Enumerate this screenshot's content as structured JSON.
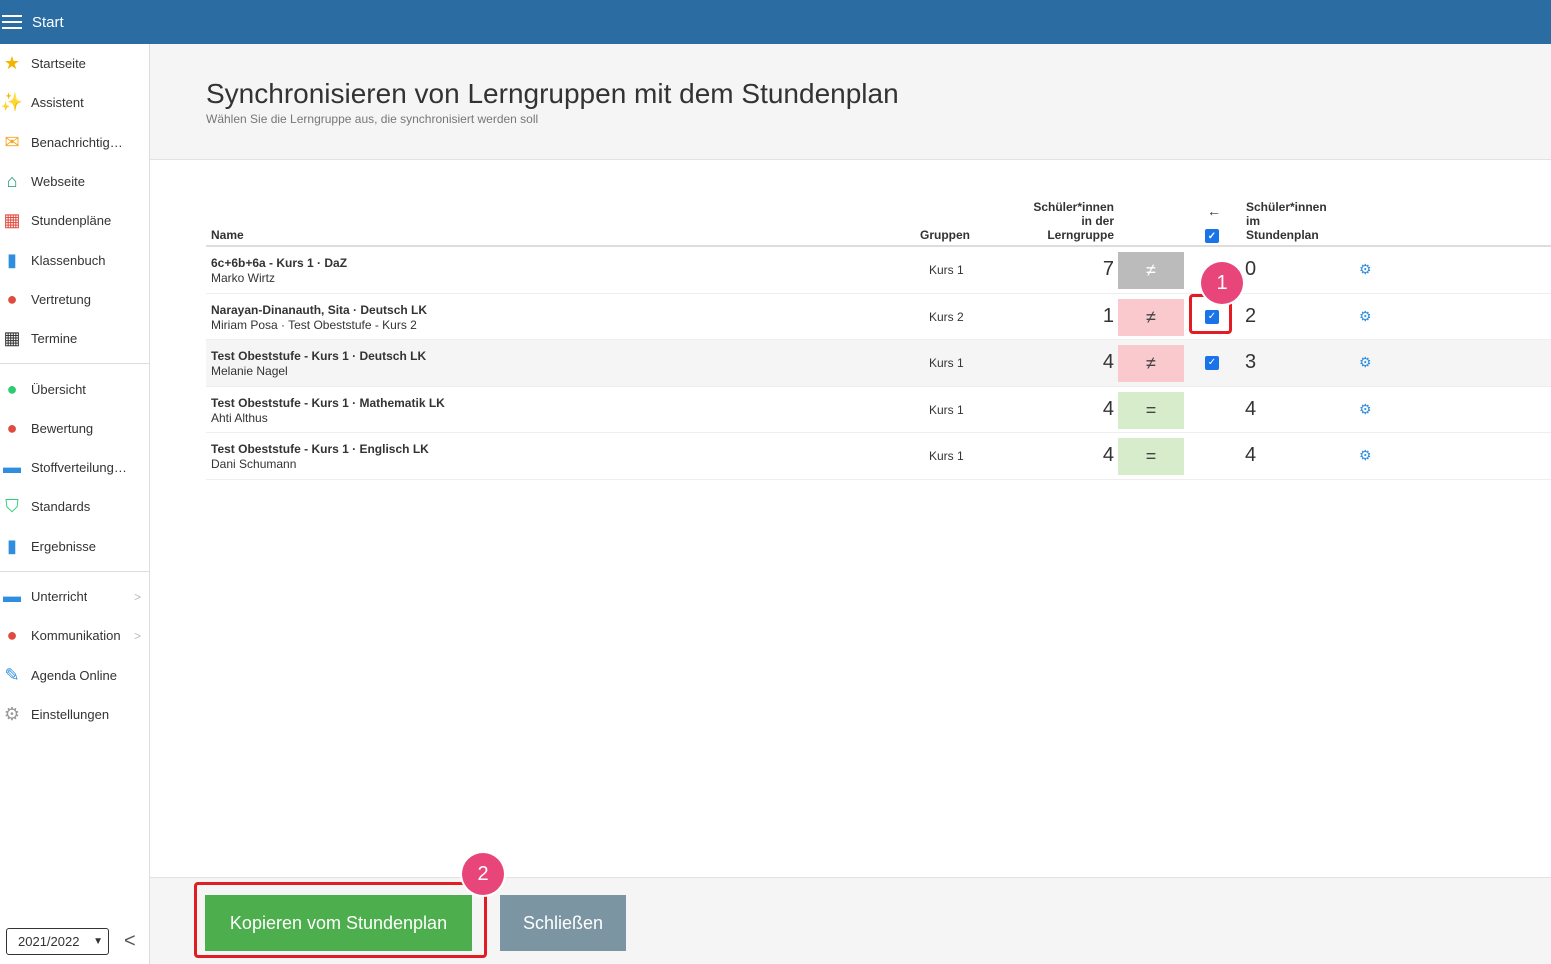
{
  "topbar": {
    "title": "Start"
  },
  "sidebar": {
    "group1": [
      {
        "label": "Startseite",
        "icon": "star-icon",
        "color": "#f5b400"
      },
      {
        "label": "Assistent",
        "icon": "magic-wand-icon",
        "color": "#e04a3f"
      },
      {
        "label": "Benachrichtigungen",
        "icon": "envelope-icon",
        "color": "#f5a623"
      },
      {
        "label": "Webseite",
        "icon": "home-icon",
        "color": "#1a9a6b"
      },
      {
        "label": "Stundenpläne",
        "icon": "timetable-icon",
        "color": "#e04a3f"
      },
      {
        "label": "Klassenbuch",
        "icon": "book-icon",
        "color": "#2f8ee0"
      },
      {
        "label": "Vertretung",
        "icon": "person-icon",
        "color": "#e04a3f"
      },
      {
        "label": "Termine",
        "icon": "calendar-icon",
        "color": "#333333"
      }
    ],
    "group2": [
      {
        "label": "Übersicht",
        "icon": "check-circle-icon",
        "color": "#2ecc71"
      },
      {
        "label": "Bewertung",
        "icon": "grading-icon",
        "color": "#e04a3f"
      },
      {
        "label": "Stoffverteilungsplan",
        "icon": "briefcase-icon",
        "color": "#2f8ee0"
      },
      {
        "label": "Standards",
        "icon": "shield-icon",
        "color": "#2ecc71"
      },
      {
        "label": "Ergebnisse",
        "icon": "bar-chart-icon",
        "color": "#2f8ee0"
      }
    ],
    "group3": [
      {
        "label": "Unterricht",
        "icon": "open-book-icon",
        "color": "#2f8ee0",
        "chevron": ">"
      },
      {
        "label": "Kommunikation",
        "icon": "chat-icon",
        "color": "#e04a3f",
        "chevron": ">"
      },
      {
        "label": "Agenda Online",
        "icon": "pen-icon",
        "color": "#2f8ee0"
      },
      {
        "label": "Einstellungen",
        "icon": "gear-icon",
        "color": "#999999"
      }
    ],
    "year": "2021/2022",
    "collapse_glyph": "<"
  },
  "header": {
    "title": "Synchronisieren von Lerngruppen mit dem Stundenplan",
    "subtitle": "Wählen Sie die Lerngruppe aus, die synchronisiert werden soll"
  },
  "table": {
    "col_name": "Name",
    "col_groups": "Gruppen",
    "col_in_group_1": "Schüler*innen",
    "col_in_group_2": "in der",
    "col_in_group_3": "Lerngruppe",
    "col_arrow": "←",
    "col_in_plan_1": "Schüler*innen",
    "col_in_plan_2": "im",
    "col_in_plan_3": "Stundenplan",
    "rows": [
      {
        "title": "6c+6b+6a - Kurs 1 · DaZ",
        "sub": "Marko Wirtz",
        "group": "Kurs 1",
        "count_group": "7",
        "compare": "≠",
        "status": "grey",
        "checked": false,
        "count_plan": "0"
      },
      {
        "title": "Narayan-Dinanauth, Sita · Deutsch LK",
        "sub": "Miriam Posa · Test Obeststufe - Kurs 2",
        "group": "Kurs 2",
        "count_group": "1",
        "compare": "≠",
        "status": "red",
        "checked": true,
        "count_plan": "2"
      },
      {
        "title": "Test Obeststufe - Kurs 1 · Deutsch LK",
        "sub": "Melanie Nagel",
        "group": "Kurs 1",
        "count_group": "4",
        "compare": "≠",
        "status": "red",
        "checked": true,
        "count_plan": "3"
      },
      {
        "title": "Test Obeststufe - Kurs 1 · Mathematik LK",
        "sub": "Ahti Althus",
        "group": "Kurs 1",
        "count_group": "4",
        "compare": "=",
        "status": "green",
        "checked": false,
        "count_plan": "4"
      },
      {
        "title": "Test Obeststufe - Kurs 1 · Englisch LK",
        "sub": "Dani Schumann",
        "group": "Kurs 1",
        "count_group": "4",
        "compare": "=",
        "status": "green",
        "checked": false,
        "count_plan": "4"
      }
    ]
  },
  "footer": {
    "copy_label": "Kopieren vom Stundenplan",
    "close_label": "Schließen"
  },
  "annotations": {
    "badge1": "1",
    "badge2": "2",
    "color": "#e31b23"
  }
}
